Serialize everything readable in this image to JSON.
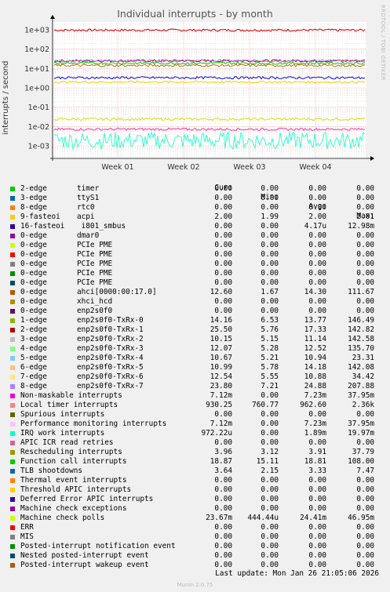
{
  "title": "Individual interrupts - by month",
  "side_label": "RRDTOOL / TOBI OETIKER",
  "y_axis_label": "interrupts / second",
  "footer_update": "Last update: Mon Jan 26 21:05:06 2026",
  "footer_version": "Munin 2.0.75",
  "legend_header": {
    "cur": "Cur:",
    "min": "Min:",
    "avg": "Avg:",
    "max": "Max:"
  },
  "chart_data": {
    "type": "line",
    "y_scale": "log",
    "ylim": [
      0.0004,
      2000
    ],
    "y_ticks": [
      "1e+03",
      "1e+02",
      "1e+01",
      "1e+00",
      "1e-01",
      "1e-02",
      "1e-03"
    ],
    "x_ticks": [
      "Week 01",
      "Week 02",
      "Week 03",
      "Week 04"
    ],
    "grid": true,
    "series": [
      {
        "name": "timer",
        "color": "#cc0000",
        "level": 962.6
      },
      {
        "name": "Local timer interrupts",
        "color": "#990033",
        "level": 25.0
      },
      {
        "name": "enp2s0f0-TxRx-7",
        "color": "#b26ef0",
        "level": 24.88
      },
      {
        "name": "IRQ work interrupts",
        "color": "#33ffcc",
        "level": 0.0019
      },
      {
        "name": "Machine check polls",
        "color": "#d8e000",
        "level": 0.0241
      },
      {
        "name": "Non-maskable interrupts",
        "color": "#ff3399",
        "level": 0.0072
      },
      {
        "name": "acpi",
        "color": "#ffcc00",
        "level": 2.0
      },
      {
        "name": "ahci[0000:00:17.0]",
        "color": "#cc6600",
        "level": 14.3
      },
      {
        "name": "Function call interrupts",
        "color": "#00cc00",
        "level": 18.8
      },
      {
        "name": "TLB shootdowns",
        "color": "#0000ff",
        "level": 3.33
      }
    ]
  },
  "legend": [
    {
      "color": "#00cc00",
      "a": "2-edge",
      "b": "timer",
      "cur": "0.00",
      "min": "0.00",
      "avg": "0.00",
      "max": "0.00"
    },
    {
      "color": "#0066b3",
      "a": "3-edge",
      "b": "ttyS1",
      "cur": "0.00",
      "min": "0.00",
      "avg": "0.00",
      "max": "0.00"
    },
    {
      "color": "#ff8000",
      "a": "8-edge",
      "b": "rtc0",
      "cur": "0.00",
      "min": "0.00",
      "avg": "0.00",
      "max": "0.00"
    },
    {
      "color": "#ffcc00",
      "a": "9-fasteoi",
      "b": "acpi",
      "cur": "2.00",
      "min": "1.99",
      "avg": "2.00",
      "max": "2.01"
    },
    {
      "color": "#330099",
      "a": "16-fasteoi",
      "b": " i801_smbus",
      "cur": "0.00",
      "min": "0.00",
      "avg": "4.17u",
      "max": "12.98m"
    },
    {
      "color": "#990099",
      "a": "0-edge",
      "b": "dmar0",
      "cur": "0.00",
      "min": "0.00",
      "avg": "0.00",
      "max": "0.00"
    },
    {
      "color": "#ccff00",
      "a": "0-edge",
      "b": "PCIe PME",
      "cur": "0.00",
      "min": "0.00",
      "avg": "0.00",
      "max": "0.00"
    },
    {
      "color": "#ff0000",
      "a": "0-edge",
      "b": "PCIe PME",
      "cur": "0.00",
      "min": "0.00",
      "avg": "0.00",
      "max": "0.00"
    },
    {
      "color": "#808080",
      "a": "0-edge",
      "b": "PCIe PME",
      "cur": "0.00",
      "min": "0.00",
      "avg": "0.00",
      "max": "0.00"
    },
    {
      "color": "#008f00",
      "a": "0-edge",
      "b": "PCIe PME",
      "cur": "0.00",
      "min": "0.00",
      "avg": "0.00",
      "max": "0.00"
    },
    {
      "color": "#00487d",
      "a": "0-edge",
      "b": "PCIe PME",
      "cur": "0.00",
      "min": "0.00",
      "avg": "0.00",
      "max": "0.00"
    },
    {
      "color": "#b35a00",
      "a": "0-edge",
      "b": "ahci[0000:00:17.0]",
      "cur": "12.60",
      "min": "1.67",
      "avg": "14.30",
      "max": "111.67"
    },
    {
      "color": "#b38f00",
      "a": "0-edge",
      "b": "xhci_hcd",
      "cur": "0.00",
      "min": "0.00",
      "avg": "0.00",
      "max": "0.00"
    },
    {
      "color": "#6b006b",
      "a": "0-edge",
      "b": "enp2s0f0",
      "cur": "0.00",
      "min": "0.00",
      "avg": "0.00",
      "max": "0.00"
    },
    {
      "color": "#8fb300",
      "a": "1-edge",
      "b": "enp2s0f0-TxRx-0",
      "cur": "14.16",
      "min": "6.53",
      "avg": "13.77",
      "max": "146.49"
    },
    {
      "color": "#b30000",
      "a": "2-edge",
      "b": "enp2s0f0-TxRx-1",
      "cur": "25.50",
      "min": "5.76",
      "avg": "17.33",
      "max": "142.82"
    },
    {
      "color": "#bebebe",
      "a": "3-edge",
      "b": "enp2s0f0-TxRx-2",
      "cur": "10.15",
      "min": "5.15",
      "avg": "11.14",
      "max": "142.58"
    },
    {
      "color": "#80ff80",
      "a": "4-edge",
      "b": "enp2s0f0-TxRx-3",
      "cur": "12.07",
      "min": "5.28",
      "avg": "12.52",
      "max": "135.70"
    },
    {
      "color": "#80c9ff",
      "a": "5-edge",
      "b": "enp2s0f0-TxRx-4",
      "cur": "10.67",
      "min": "5.21",
      "avg": "10.94",
      "max": "23.31"
    },
    {
      "color": "#ffc080",
      "a": "6-edge",
      "b": "enp2s0f0-TxRx-5",
      "cur": "10.99",
      "min": "5.78",
      "avg": "14.18",
      "max": "142.08"
    },
    {
      "color": "#ffe680",
      "a": "7-edge",
      "b": "enp2s0f0-TxRx-6",
      "cur": "12.54",
      "min": "5.55",
      "avg": "10.88",
      "max": "34.42"
    },
    {
      "color": "#aa80ff",
      "a": "8-edge",
      "b": "enp2s0f0-TxRx-7",
      "cur": "23.80",
      "min": "7.21",
      "avg": "24.88",
      "max": "207.88"
    },
    {
      "color": "#ee00cc",
      "a": "Non-maskable interrupts",
      "b": "",
      "cur": "7.12m",
      "min": "0.00",
      "avg": "7.23m",
      "max": "37.95m"
    },
    {
      "color": "#ff8080",
      "a": "Local timer interrupts",
      "b": "",
      "cur": "930.25",
      "min": "760.77",
      "avg": "962.60",
      "max": "2.36k"
    },
    {
      "color": "#666600",
      "a": "Spurious interrupts",
      "b": "",
      "cur": "0.00",
      "min": "0.00",
      "avg": "0.00",
      "max": "0.00"
    },
    {
      "color": "#ffbfff",
      "a": "Performance monitoring interrupts",
      "b": "",
      "cur": "7.12m",
      "min": "0.00",
      "avg": "7.23m",
      "max": "37.95m"
    },
    {
      "color": "#00ffcc",
      "a": "IRQ work interrupts",
      "b": "",
      "cur": "972.22u",
      "min": "0.00",
      "avg": "1.89m",
      "max": "19.97m"
    },
    {
      "color": "#cc6699",
      "a": "APIC ICR read retries",
      "b": "",
      "cur": "0.00",
      "min": "0.00",
      "avg": "0.00",
      "max": "0.00"
    },
    {
      "color": "#999900",
      "a": "Rescheduling interrupts",
      "b": "",
      "cur": "3.96",
      "min": "3.12",
      "avg": "3.91",
      "max": "37.79"
    },
    {
      "color": "#00cc00",
      "a": "Function call interrupts",
      "b": "",
      "cur": "18.87",
      "min": "15.11",
      "avg": "18.81",
      "max": "108.00"
    },
    {
      "color": "#0066b3",
      "a": "TLB shootdowns",
      "b": "",
      "cur": "3.64",
      "min": "2.15",
      "avg": "3.33",
      "max": "7.47"
    },
    {
      "color": "#ff8000",
      "a": "Thermal event interrupts",
      "b": "",
      "cur": "0.00",
      "min": "0.00",
      "avg": "0.00",
      "max": "0.00"
    },
    {
      "color": "#ffcc00",
      "a": "Threshold APIC interrupts",
      "b": "",
      "cur": "0.00",
      "min": "0.00",
      "avg": "0.00",
      "max": "0.00"
    },
    {
      "color": "#330099",
      "a": "Deferred Error APIC interrupts",
      "b": "",
      "cur": "0.00",
      "min": "0.00",
      "avg": "0.00",
      "max": "0.00"
    },
    {
      "color": "#990099",
      "a": "Machine check exceptions",
      "b": "",
      "cur": "0.00",
      "min": "0.00",
      "avg": "0.00",
      "max": "0.00"
    },
    {
      "color": "#ccff00",
      "a": "Machine check polls",
      "b": "",
      "cur": "23.67m",
      "min": "444.44u",
      "avg": "24.41m",
      "max": "46.95m"
    },
    {
      "color": "#ff0000",
      "a": "ERR",
      "b": "",
      "cur": "0.00",
      "min": "0.00",
      "avg": "0.00",
      "max": "0.00"
    },
    {
      "color": "#808080",
      "a": "MIS",
      "b": "",
      "cur": "0.00",
      "min": "0.00",
      "avg": "0.00",
      "max": "0.00"
    },
    {
      "color": "#008f00",
      "a": "Posted-interrupt notification event",
      "b": "",
      "cur": "0.00",
      "min": "0.00",
      "avg": "0.00",
      "max": "0.00"
    },
    {
      "color": "#00487d",
      "a": "Nested posted-interrupt event",
      "b": "",
      "cur": "0.00",
      "min": "0.00",
      "avg": "0.00",
      "max": "0.00"
    },
    {
      "color": "#b35a00",
      "a": "Posted-interrupt wakeup event",
      "b": "",
      "cur": "0.00",
      "min": "0.00",
      "avg": "0.00",
      "max": "0.00"
    }
  ]
}
